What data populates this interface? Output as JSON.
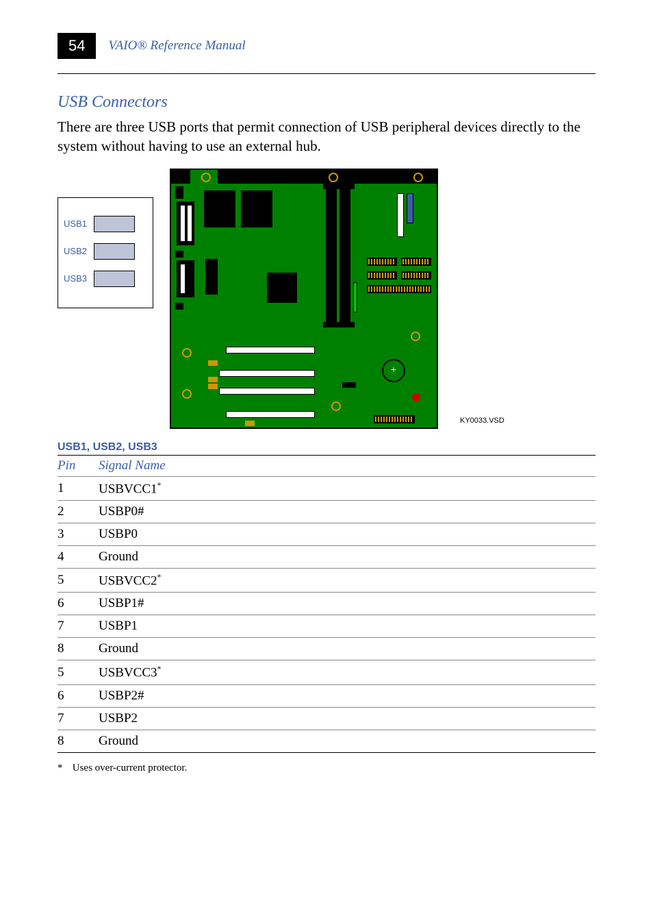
{
  "header": {
    "page_number": "54",
    "title": "VAIO® Reference Manual"
  },
  "section": {
    "heading": "USB Connectors",
    "paragraph": "There are three USB ports that permit connection of USB peripheral devices directly to the system without having to use an external hub."
  },
  "io_labels": {
    "usb1": "USB1",
    "usb2": "USB2",
    "usb3": "USB3"
  },
  "figure_caption": "KY0033.VSD",
  "table": {
    "title": "USB1, USB2, USB3",
    "col_pin": "Pin",
    "col_signal": "Signal Name",
    "rows": [
      {
        "pin": "1",
        "signal": "USBVCC1",
        "sup": "*"
      },
      {
        "pin": "2",
        "signal": "USBP0#",
        "sup": ""
      },
      {
        "pin": "3",
        "signal": "USBP0",
        "sup": ""
      },
      {
        "pin": "4",
        "signal": "Ground",
        "sup": ""
      },
      {
        "pin": "5",
        "signal": "USBVCC2",
        "sup": "*"
      },
      {
        "pin": "6",
        "signal": "USBP1#",
        "sup": ""
      },
      {
        "pin": "7",
        "signal": "USBP1",
        "sup": ""
      },
      {
        "pin": "8",
        "signal": "Ground",
        "sup": ""
      },
      {
        "pin": "5",
        "signal": "USBVCC3",
        "sup": "*"
      },
      {
        "pin": "6",
        "signal": "USBP2#",
        "sup": ""
      },
      {
        "pin": "7",
        "signal": "USBP2",
        "sup": ""
      },
      {
        "pin": "8",
        "signal": "Ground",
        "sup": ""
      }
    ]
  },
  "footnote": {
    "marker": "*",
    "text": "Uses over-current protector."
  }
}
